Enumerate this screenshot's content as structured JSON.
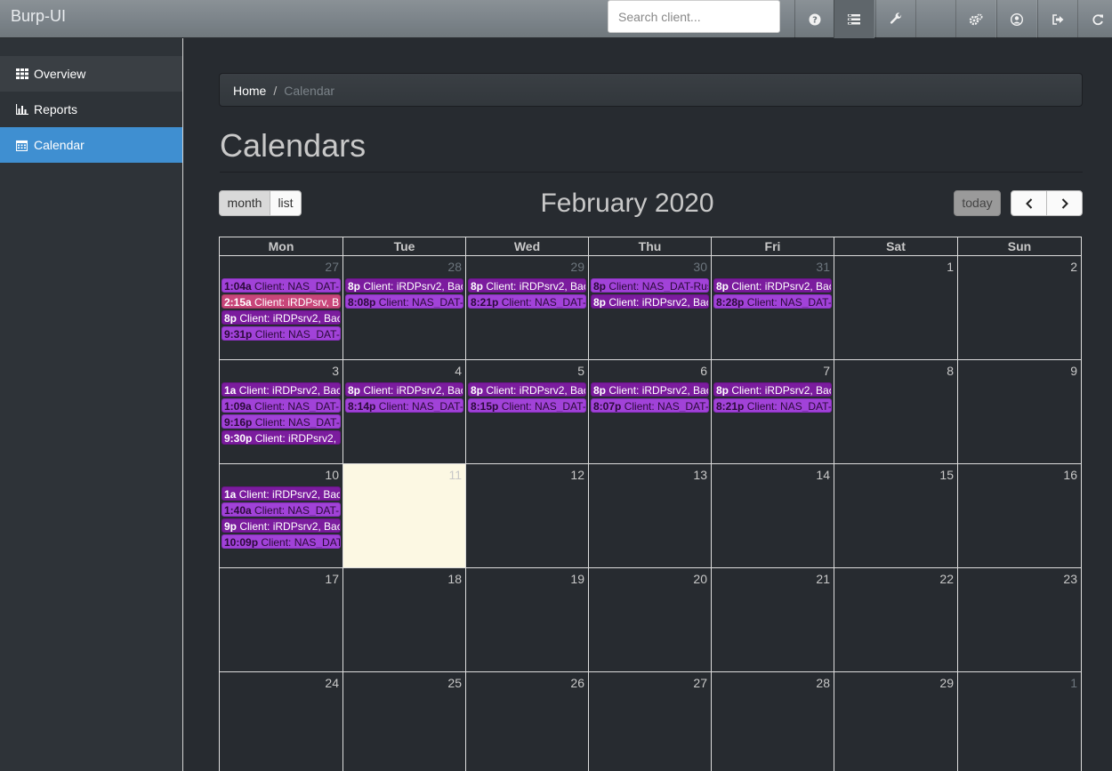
{
  "app": {
    "brand": "Burp-UI"
  },
  "search": {
    "placeholder": "Search client..."
  },
  "nav_icons": [
    "help-icon",
    "list-icon",
    "wrench-icon",
    "blank",
    "cogs-icon",
    "user-icon",
    "logout-icon",
    "refresh-icon"
  ],
  "sidebar": {
    "items": [
      {
        "label": "Overview",
        "icon": "table-icon"
      },
      {
        "label": "Reports",
        "icon": "bar-chart-icon"
      },
      {
        "label": "Calendar",
        "icon": "calendar-icon",
        "active": true
      }
    ]
  },
  "breadcrumb": {
    "home": "Home",
    "separator": "/",
    "current": "Calendar"
  },
  "page": {
    "title": "Calendars"
  },
  "toolbar": {
    "month": "month",
    "list": "list",
    "title": "February 2020",
    "today": "today"
  },
  "calendar": {
    "days_of_week": [
      "Mon",
      "Tue",
      "Wed",
      "Thu",
      "Fri",
      "Sat",
      "Sun"
    ],
    "weeks": [
      [
        {
          "day": "27",
          "other": true,
          "events": [
            {
              "time": "1:04a",
              "text": "Client: NAS_DAT-I",
              "color": "purple"
            },
            {
              "time": "2:15a",
              "text": "Client: iRDPsrv, B",
              "color": "pink"
            },
            {
              "time": "8p",
              "text": "Client: iRDPsrv2, Bac",
              "color": "dark"
            },
            {
              "time": "9:31p",
              "text": "Client: NAS_DAT-",
              "color": "purple"
            }
          ]
        },
        {
          "day": "28",
          "other": true,
          "events": [
            {
              "time": "8p",
              "text": "Client: iRDPsrv2, Bac",
              "color": "dark"
            },
            {
              "time": "8:08p",
              "text": "Client: NAS_DAT-",
              "color": "purple"
            }
          ]
        },
        {
          "day": "29",
          "other": true,
          "events": [
            {
              "time": "8p",
              "text": "Client: iRDPsrv2, Bac",
              "color": "dark"
            },
            {
              "time": "8:21p",
              "text": "Client: NAS_DAT-",
              "color": "purple"
            }
          ]
        },
        {
          "day": "30",
          "other": true,
          "events": [
            {
              "time": "8p",
              "text": "Client: NAS_DAT-Rus",
              "color": "purple"
            },
            {
              "time": "8p",
              "text": "Client: iRDPsrv2, Bac",
              "color": "dark"
            }
          ]
        },
        {
          "day": "31",
          "other": true,
          "events": [
            {
              "time": "8p",
              "text": "Client: iRDPsrv2, Bac",
              "color": "dark"
            },
            {
              "time": "8:28p",
              "text": "Client: NAS_DAT-",
              "color": "purple"
            }
          ]
        },
        {
          "day": "1",
          "events": []
        },
        {
          "day": "2",
          "events": []
        }
      ],
      [
        {
          "day": "3",
          "events": [
            {
              "time": "1a",
              "text": "Client: iRDPsrv2, Bac",
              "color": "dark"
            },
            {
              "time": "1:09a",
              "text": "Client: NAS_DAT-I",
              "color": "purple"
            },
            {
              "time": "9:16p",
              "text": "Client: NAS_DAT-",
              "color": "purple"
            },
            {
              "time": "9:30p",
              "text": "Client: iRDPsrv2, I",
              "color": "dark"
            }
          ]
        },
        {
          "day": "4",
          "events": [
            {
              "time": "8p",
              "text": "Client: iRDPsrv2, Bac",
              "color": "dark"
            },
            {
              "time": "8:14p",
              "text": "Client: NAS_DAT-",
              "color": "purple"
            }
          ]
        },
        {
          "day": "5",
          "events": [
            {
              "time": "8p",
              "text": "Client: iRDPsrv2, Bac",
              "color": "dark"
            },
            {
              "time": "8:15p",
              "text": "Client: NAS_DAT-",
              "color": "purple"
            }
          ]
        },
        {
          "day": "6",
          "events": [
            {
              "time": "8p",
              "text": "Client: iRDPsrv2, Bac",
              "color": "dark"
            },
            {
              "time": "8:07p",
              "text": "Client: NAS_DAT-",
              "color": "purple"
            }
          ]
        },
        {
          "day": "7",
          "events": [
            {
              "time": "8p",
              "text": "Client: iRDPsrv2, Bac",
              "color": "dark"
            },
            {
              "time": "8:21p",
              "text": "Client: NAS_DAT-",
              "color": "purple"
            }
          ]
        },
        {
          "day": "8",
          "events": []
        },
        {
          "day": "9",
          "events": []
        }
      ],
      [
        {
          "day": "10",
          "events": [
            {
              "time": "1a",
              "text": "Client: iRDPsrv2, Bac",
              "color": "dark"
            },
            {
              "time": "1:40a",
              "text": "Client: NAS_DAT-I",
              "color": "purple"
            },
            {
              "time": "9p",
              "text": "Client: iRDPsrv2, Bac",
              "color": "dark"
            },
            {
              "time": "10:09p",
              "text": "Client: NAS_DAT",
              "color": "purple"
            }
          ]
        },
        {
          "day": "11",
          "today": true,
          "events": []
        },
        {
          "day": "12",
          "events": []
        },
        {
          "day": "13",
          "events": []
        },
        {
          "day": "14",
          "events": []
        },
        {
          "day": "15",
          "events": []
        },
        {
          "day": "16",
          "events": []
        }
      ],
      [
        {
          "day": "17",
          "events": []
        },
        {
          "day": "18",
          "events": []
        },
        {
          "day": "19",
          "events": []
        },
        {
          "day": "20",
          "events": []
        },
        {
          "day": "21",
          "events": []
        },
        {
          "day": "22",
          "events": []
        },
        {
          "day": "23",
          "events": []
        }
      ],
      [
        {
          "day": "24",
          "events": []
        },
        {
          "day": "25",
          "events": []
        },
        {
          "day": "26",
          "events": []
        },
        {
          "day": "27",
          "events": []
        },
        {
          "day": "28",
          "events": []
        },
        {
          "day": "29",
          "events": []
        },
        {
          "day": "1",
          "other": true,
          "events": []
        }
      ]
    ]
  }
}
